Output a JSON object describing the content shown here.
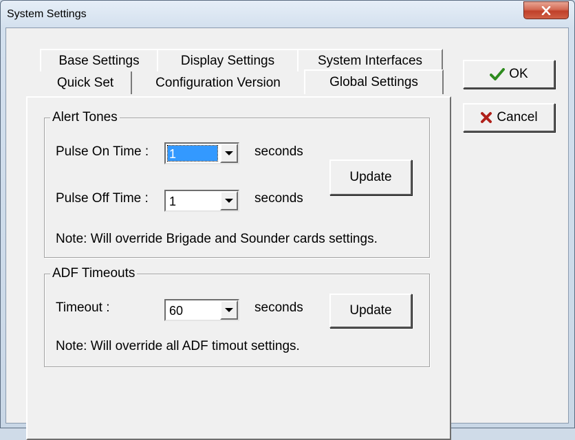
{
  "window": {
    "title": "System Settings",
    "close_icon": "close-icon"
  },
  "tabs": {
    "row1": [
      "Base Settings",
      "Display Settings",
      "System Interfaces"
    ],
    "row2": [
      "Quick Set",
      "Configuration Version",
      "Global Settings"
    ],
    "active": "Global Settings"
  },
  "alert_tones": {
    "title": "Alert Tones",
    "pulse_on_label": "Pulse On Time :",
    "pulse_on_value": "1",
    "pulse_off_label": "Pulse Off Time :",
    "pulse_off_value": "1",
    "seconds_label": "seconds",
    "update_label": "Update",
    "note": "Note: Will override Brigade and Sounder cards settings."
  },
  "adf_timeouts": {
    "title": "ADF Timeouts",
    "timeout_label": "Timeout :",
    "timeout_value": "60",
    "seconds_label": "seconds",
    "update_label": "Update",
    "note": "Note: Will override all ADF timout settings."
  },
  "buttons": {
    "ok_label": "OK",
    "cancel_label": "Cancel"
  },
  "colors": {
    "ok_icon": "#2e8b1e",
    "cancel_icon": "#b0201a",
    "selection": "#3399ff",
    "close_button": "#c9452c"
  }
}
